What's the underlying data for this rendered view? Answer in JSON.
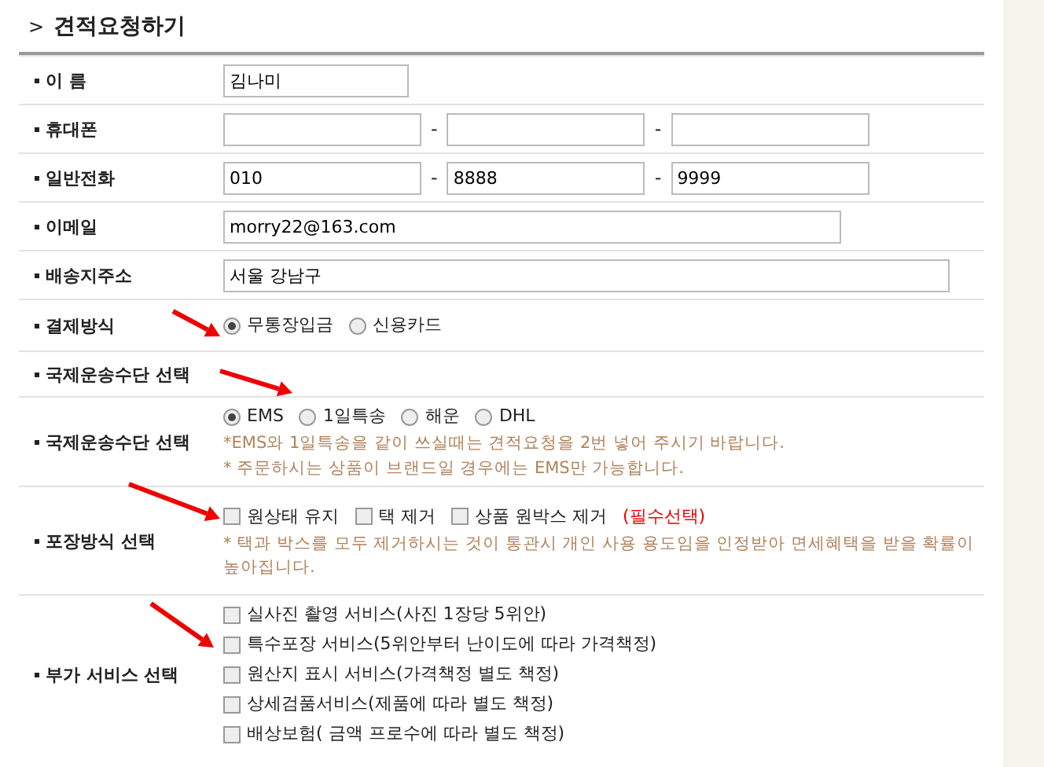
{
  "heading": {
    "marker": ">",
    "title": "견적요청하기"
  },
  "rows": [
    {
      "kind": "short-text",
      "label": "이 름",
      "value": "김나미"
    },
    {
      "kind": "phone",
      "label": "휴대폰",
      "separators": [
        "-",
        "-"
      ]
    },
    {
      "kind": "phone",
      "label": "일반전화",
      "parts": [
        "010",
        "8888",
        "9999"
      ],
      "separators": [
        "-",
        "-"
      ]
    },
    {
      "kind": "text",
      "label": "이메일",
      "value": "morry22@163.com"
    },
    {
      "kind": "long-text",
      "label": "배송지주소",
      "value": "서울 강남구"
    },
    {
      "kind": "radio",
      "label": "결제방식",
      "options": [
        {
          "label": "무통장입금",
          "selected": true
        },
        {
          "label": "신용카드",
          "selected": false
        }
      ],
      "notes": []
    },
    {
      "kind": "label",
      "label": "국제운송수단 선택"
    },
    {
      "kind": "radio",
      "label": "국제운송수단 선택",
      "options": [
        {
          "label": "EMS",
          "selected": true
        },
        {
          "label": "1일특송",
          "selected": false
        },
        {
          "label": "해운",
          "selected": false
        },
        {
          "label": "DHL",
          "selected": false
        }
      ],
      "notes": [
        "*EMS와 1일특송을 같이 쓰실때는 견적요청을 2번 넣어 주시기 바랍니다.",
        "* 주문하시는 상품이 브랜드일 경우에는 EMS만 가능합니다."
      ]
    },
    {
      "kind": "checks",
      "label": "포장방식 선택",
      "options": [
        {
          "label": "원상태 유지",
          "checked": false
        },
        {
          "label": "택 제거",
          "checked": false
        },
        {
          "label": "상품 원박스 제거",
          "checked": false
        }
      ],
      "required": "(필수선택)",
      "notes": [
        "* 택과 박스를 모두 제거하시는 것이 통관시 개인 사용 용도임을 인정받아 면세혜택을 받을 확률이 높아집니다."
      ]
    },
    {
      "kind": "checklist",
      "label": "부가 서비스 선택",
      "options": [
        {
          "label": "실사진 촬영 서비스(사진 1장당 5위안)",
          "checked": false
        },
        {
          "label": "특수포장 서비스(5위안부터 난이도에 따라 가격책정)",
          "checked": false
        },
        {
          "label": "원산지 표시 서비스(가격책정 별도 책정)",
          "checked": false
        },
        {
          "label": "상세검품서비스(제품에 따라 별도 책정)",
          "checked": false
        },
        {
          "label": "배상보험( 금액 프로수에 따라 별도 책정)",
          "checked": false
        }
      ]
    }
  ]
}
